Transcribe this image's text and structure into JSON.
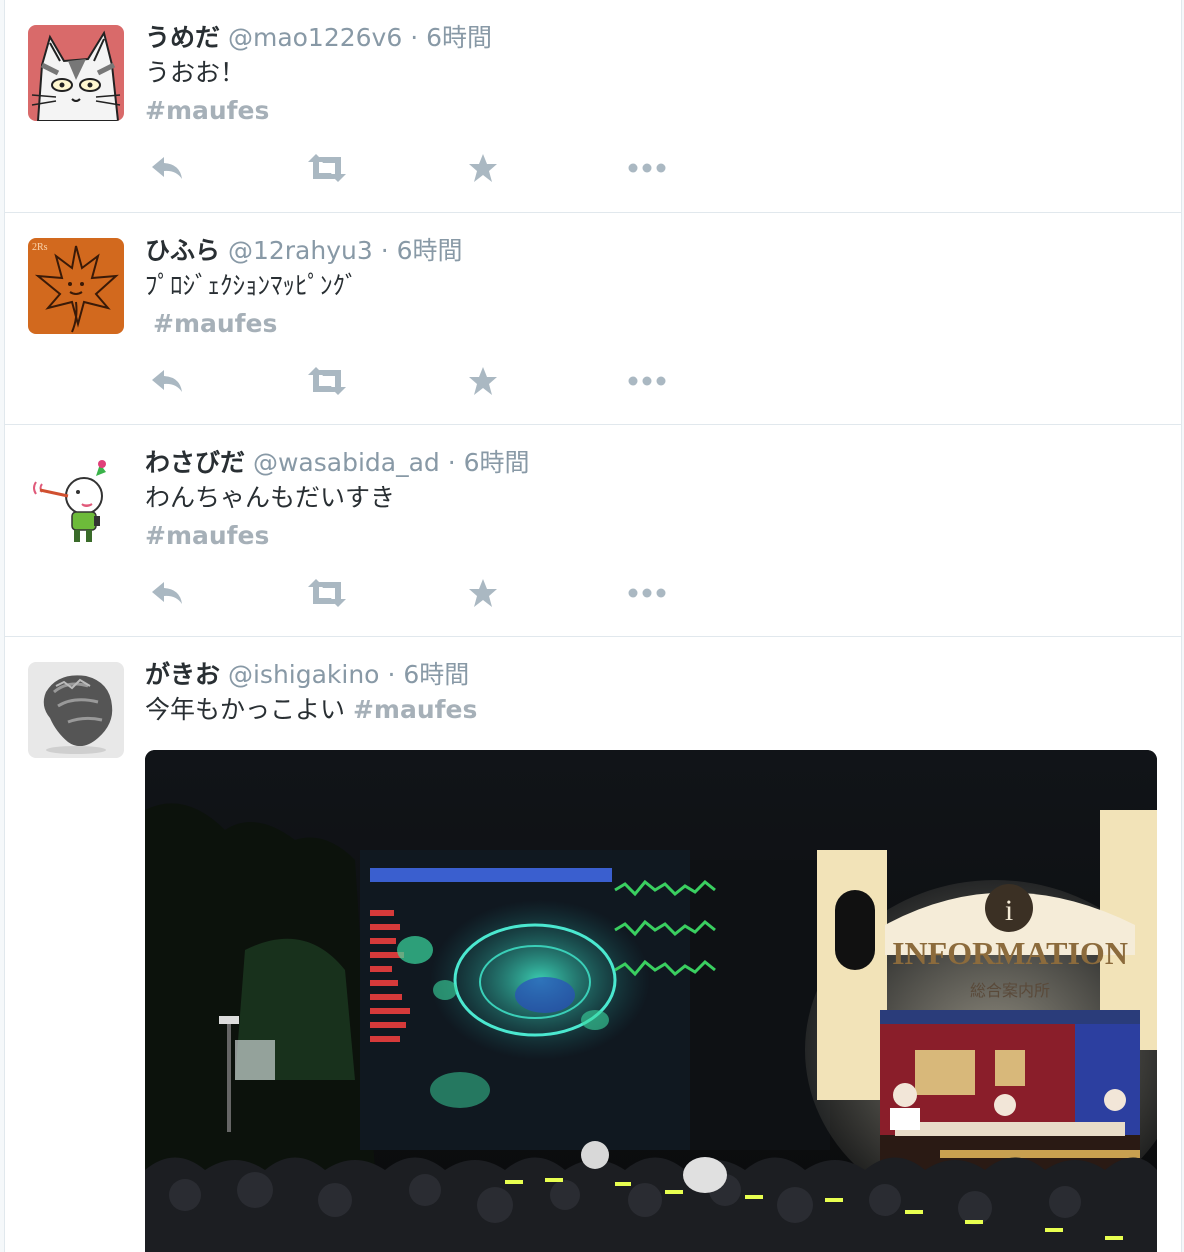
{
  "tweets": [
    {
      "fullname": "うめだ",
      "handle": "@mao1226v6",
      "separator": "·",
      "time": "6時間",
      "text_lines": [
        "うおお！"
      ],
      "hashtag": "#maufes",
      "avatar_icon": "cat-avatar-icon",
      "avatar_color": "#d96a6a"
    },
    {
      "fullname": "ひふら",
      "handle": "@12rahyu3",
      "separator": "·",
      "time": "6時間",
      "text_lines": [
        "ﾌﾟﾛｼﾞｪｸｼｮﾝﾏｯﾋﾟﾝｸﾞ"
      ],
      "hashtag": "#maufes",
      "avatar_icon": "maple-leaf-avatar-icon",
      "avatar_label": "2Rs",
      "avatar_color": "#d2691e"
    },
    {
      "fullname": "わさびだ",
      "handle": "@wasabida_ad",
      "separator": "·",
      "time": "6時間",
      "text_lines": [
        "わんちゃんもだいすき"
      ],
      "hashtag": "#maufes",
      "avatar_icon": "cartoon-character-avatar-icon",
      "avatar_color": "#ffffff"
    },
    {
      "fullname": "がきお",
      "handle": "@ishigakino",
      "separator": "·",
      "time": "6時間",
      "text_lines": [
        "今年もかっこよい"
      ],
      "hashtag": "#maufes",
      "avatar_icon": "rock-avatar-icon",
      "avatar_color": "#e8e8e8"
    }
  ],
  "actions": {
    "reply_icon": "reply-icon",
    "retweet_icon": "retweet-icon",
    "favorite_icon": "star-icon",
    "more_icon": "more-dots-icon",
    "color": "#aab8c2"
  },
  "media": {
    "sign_text": "INFORMATION",
    "sign_subtext": "総合案内所"
  }
}
